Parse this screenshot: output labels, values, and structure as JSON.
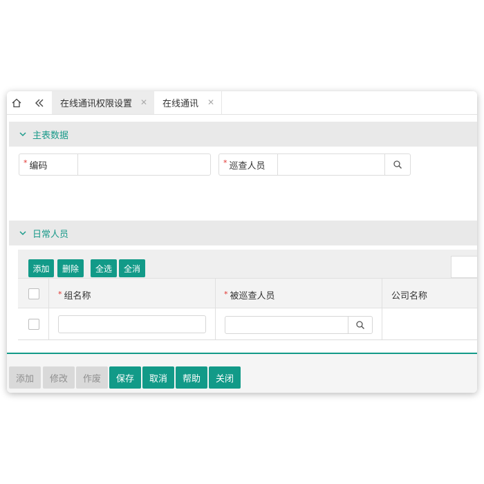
{
  "tabs": [
    {
      "label": "在线通讯权限设置",
      "active": true
    },
    {
      "label": "在线通讯",
      "active": false
    }
  ],
  "sections": {
    "main": {
      "title": "主表数据"
    },
    "daily": {
      "title": "日常人员"
    }
  },
  "form": {
    "code_label": "编码",
    "code_value": "",
    "inspector_label": "巡查人员",
    "inspector_value": ""
  },
  "grid_toolbar": {
    "add": "添加",
    "delete": "删除",
    "select_all": "全选",
    "deselect_all": "全消"
  },
  "grid": {
    "columns": [
      "组名称",
      "被巡查人员",
      "公司名称"
    ],
    "rows": [
      {
        "group_name": "",
        "inspected_person": "",
        "company": ""
      }
    ]
  },
  "bottom_buttons": [
    {
      "label": "添加",
      "enabled": false
    },
    {
      "label": "修改",
      "enabled": false
    },
    {
      "label": "作废",
      "enabled": false
    },
    {
      "label": "保存",
      "enabled": true
    },
    {
      "label": "取消",
      "enabled": true
    },
    {
      "label": "帮助",
      "enabled": true
    },
    {
      "label": "关闭",
      "enabled": true
    }
  ],
  "colors": {
    "accent": "#129a88",
    "section_text": "#1a9a8a",
    "required": "#e0322d"
  },
  "icons": [
    "home-icon",
    "double-chevron-left-icon",
    "close-icon",
    "chevron-down-icon",
    "search-icon"
  ]
}
